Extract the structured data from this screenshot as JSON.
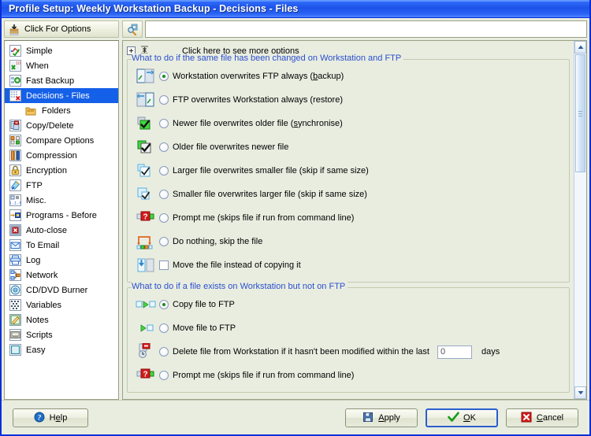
{
  "window": {
    "title": "Profile Setup: Weekly Workstation Backup  -  Decisions  -  Files"
  },
  "sidebar": {
    "header_label": "Click For Options",
    "header_icon": "options-stack-icon",
    "items": [
      {
        "label": "Simple",
        "icon": "simple-icon",
        "selected": false,
        "child": false
      },
      {
        "label": "When",
        "icon": "when-icon",
        "selected": false,
        "child": false
      },
      {
        "label": "Fast Backup",
        "icon": "fast-backup-icon",
        "selected": false,
        "child": false
      },
      {
        "label": "Decisions - Files",
        "icon": "decisions-icon",
        "selected": true,
        "child": false
      },
      {
        "label": "Folders",
        "icon": "folders-icon",
        "selected": false,
        "child": true
      },
      {
        "label": "Copy/Delete",
        "icon": "copy-delete-icon",
        "selected": false,
        "child": false
      },
      {
        "label": "Compare Options",
        "icon": "compare-icon",
        "selected": false,
        "child": false
      },
      {
        "label": "Compression",
        "icon": "compression-icon",
        "selected": false,
        "child": false
      },
      {
        "label": "Encryption",
        "icon": "encryption-icon",
        "selected": false,
        "child": false
      },
      {
        "label": "FTP",
        "icon": "ftp-icon",
        "selected": false,
        "child": false
      },
      {
        "label": "Misc.",
        "icon": "misc-icon",
        "selected": false,
        "child": false
      },
      {
        "label": "Programs - Before",
        "icon": "programs-icon",
        "selected": false,
        "child": false
      },
      {
        "label": "Auto-close",
        "icon": "auto-close-icon",
        "selected": false,
        "child": false
      },
      {
        "label": "To Email",
        "icon": "email-icon",
        "selected": false,
        "child": false
      },
      {
        "label": "Log",
        "icon": "log-icon",
        "selected": false,
        "child": false
      },
      {
        "label": "Network",
        "icon": "network-icon",
        "selected": false,
        "child": false
      },
      {
        "label": "CD/DVD Burner",
        "icon": "cd-dvd-icon",
        "selected": false,
        "child": false
      },
      {
        "label": "Variables",
        "icon": "variables-icon",
        "selected": false,
        "child": false
      },
      {
        "label": "Notes",
        "icon": "notes-icon",
        "selected": false,
        "child": false
      },
      {
        "label": "Scripts",
        "icon": "scripts-icon",
        "selected": false,
        "child": false
      },
      {
        "label": "Easy",
        "icon": "easy-icon",
        "selected": false,
        "child": false
      }
    ]
  },
  "search": {
    "icon": "search-options-icon",
    "value": "",
    "placeholder": ""
  },
  "more_options": {
    "expand_icon": "expand-plus-icon",
    "collapse_icon": "collapse-all-icon",
    "label": "Click here to see more options"
  },
  "groups": [
    {
      "title": "What to do if the same file has been changed on Workstation and FTP",
      "options": [
        {
          "type": "radio",
          "checked": true,
          "icon": "workstation-to-ftp-icon",
          "label_pre": "Workstation overwrites FTP always (",
          "label_accel": "b",
          "label_post": "ackup)"
        },
        {
          "type": "radio",
          "checked": false,
          "icon": "ftp-to-workstation-icon",
          "label": "FTP overwrites Workstation always (restore)"
        },
        {
          "type": "radio",
          "checked": false,
          "icon": "newer-file-icon",
          "label_pre": "Newer file overwrites older file (",
          "label_accel": "s",
          "label_post": "ynchronise)"
        },
        {
          "type": "radio",
          "checked": false,
          "icon": "older-file-icon",
          "label": "Older file overwrites newer file"
        },
        {
          "type": "radio",
          "checked": false,
          "icon": "larger-file-icon",
          "label": "Larger file overwrites smaller file (skip if same size)"
        },
        {
          "type": "radio",
          "checked": false,
          "icon": "smaller-file-icon",
          "label": "Smaller file overwrites larger file (skip if same size)"
        },
        {
          "type": "radio",
          "checked": false,
          "icon": "prompt-me-icon",
          "label": "Prompt me (skips file if run from command line)"
        },
        {
          "type": "radio",
          "checked": false,
          "icon": "do-nothing-icon",
          "label": "Do nothing, skip the file"
        },
        {
          "type": "checkbox",
          "checked": false,
          "icon": "move-file-icon",
          "label": "Move the file instead of copying it"
        }
      ]
    },
    {
      "title": "What to do if a file exists on Workstation but not on FTP",
      "options": [
        {
          "type": "radio",
          "checked": true,
          "icon": "copy-to-ftp-icon",
          "label": "Copy file to FTP"
        },
        {
          "type": "radio",
          "checked": false,
          "icon": "move-to-ftp-icon",
          "label": "Move file to FTP"
        },
        {
          "type": "radio",
          "checked": false,
          "icon": "delete-file-icon",
          "label": "Delete file from Workstation if it hasn't been modified within the last",
          "field_value": "0",
          "field_suffix": "days"
        },
        {
          "type": "radio",
          "checked": false,
          "icon": "prompt-me-icon",
          "label": "Prompt me  (skips file if run from command line)"
        }
      ]
    }
  ],
  "buttons": {
    "help": {
      "label_pre": "H",
      "label_accel": "e",
      "label_post": "lp",
      "icon": "help-icon"
    },
    "apply": {
      "label_pre": "",
      "label_accel": "A",
      "label_post": "pply",
      "icon": "save-icon"
    },
    "ok": {
      "label_pre": "",
      "label_accel": "O",
      "label_post": "K",
      "icon": "check-icon",
      "default": true
    },
    "cancel": {
      "label_pre": "",
      "label_accel": "C",
      "label_post": "ancel",
      "icon": "cancel-icon"
    }
  },
  "colors": {
    "titlebar": "#1d52e8",
    "panel_bg": "#e9ede0",
    "selection": "#1560e8",
    "group_title": "#2a4fcf",
    "radio_dot": "#1d8a1d"
  }
}
